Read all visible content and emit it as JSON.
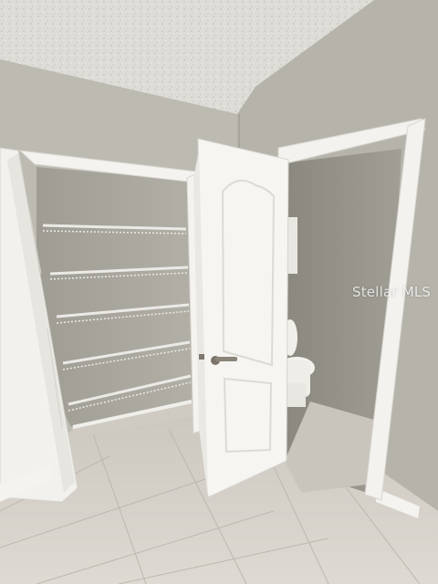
{
  "photo": {
    "subject": "bathroom-closet-and-toilet-room",
    "watermark_text": "Stellar MLS"
  },
  "colors": {
    "wall": "#b8b5ac",
    "ceiling": "#dfddd8",
    "trim": "#f4f3ef",
    "floor": "#d8d4cc",
    "shelf": "#eceae6"
  }
}
